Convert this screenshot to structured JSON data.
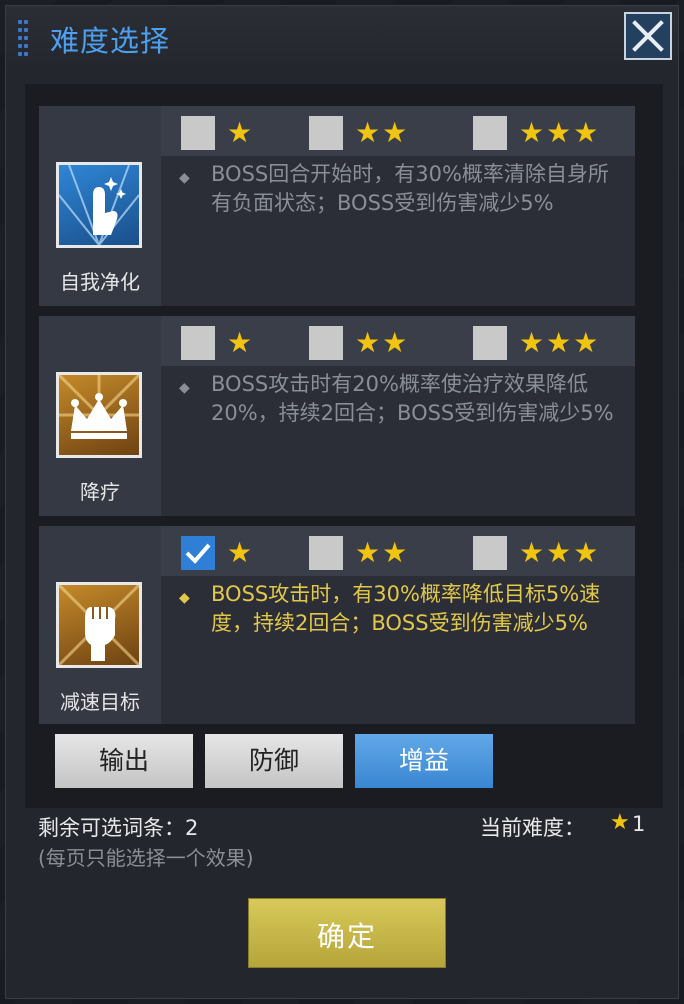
{
  "window": {
    "title": "难度选择"
  },
  "star_options": [
    "★",
    "★★",
    "★★★"
  ],
  "skills": [
    {
      "name": "自我净化",
      "checked": [
        false,
        false,
        false
      ],
      "desc_bullet": "◆",
      "description": "BOSS回合开始时，有30%概率清除自身所有负面状态；BOSS受到伤害减少5%",
      "active": false,
      "icon": "hand-sparkle-icon"
    },
    {
      "name": "降疗",
      "checked": [
        false,
        false,
        false
      ],
      "desc_bullet": "◆",
      "description": "BOSS攻击时有20%概率使治疗效果降低20%，持续2回合；BOSS受到伤害减少5%",
      "active": false,
      "icon": "crown-icon"
    },
    {
      "name": "减速目标",
      "checked": [
        true,
        false,
        false
      ],
      "desc_bullet": "◆",
      "description": "BOSS攻击时，有30%概率降低目标5%速度，持续2回合；BOSS受到伤害减少5%",
      "active": true,
      "icon": "fist-icon"
    }
  ],
  "tabs": [
    {
      "label": "输出",
      "selected": false
    },
    {
      "label": "防御",
      "selected": false
    },
    {
      "label": "增益",
      "selected": true
    }
  ],
  "footer": {
    "remaining_label": "剩余可选词条：2",
    "hint": "(每页只能选择一个效果)",
    "difficulty_label": "当前难度：",
    "difficulty_star": "★",
    "difficulty_value": "1"
  },
  "confirm_label": "确定",
  "colors": {
    "accent_blue": "#4da0f0",
    "star_gold": "#f1c40f",
    "active_text": "#e2c84a"
  }
}
